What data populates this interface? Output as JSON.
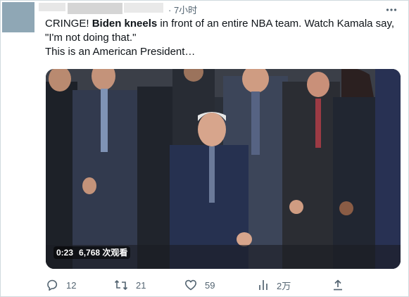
{
  "header": {
    "timestamp": "· 7小时"
  },
  "tweet": {
    "text_part1": "CRINGE! ",
    "text_bold": "Biden kneels",
    "text_part2": " in front of an entire NBA team. Watch Kamala say, \"I'm not doing that.\"",
    "text_line3": "This is an American President…"
  },
  "video": {
    "duration": "0:23",
    "views": "6,768 次观看"
  },
  "actions": {
    "reply_count": "12",
    "retweet_count": "21",
    "like_count": "59",
    "views_count": "2万"
  },
  "colors": {
    "text": "#0f1419",
    "secondary": "#536471",
    "border": "#cfd9de"
  },
  "icons": [
    "more-icon",
    "reply-icon",
    "retweet-icon",
    "like-icon",
    "analytics-icon",
    "share-icon"
  ]
}
